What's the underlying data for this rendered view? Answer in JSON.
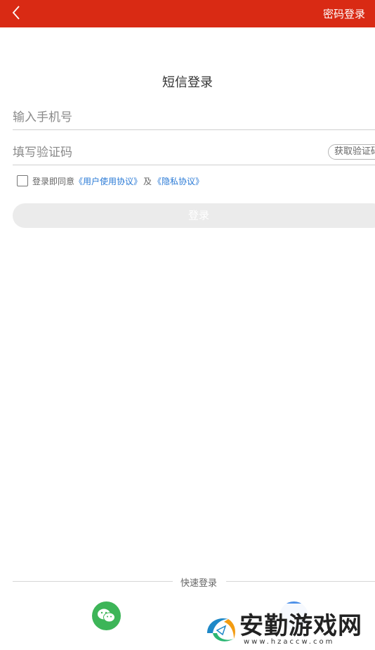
{
  "header": {
    "back_icon": "chevron-left-icon",
    "password_login": "密码登录",
    "bar_color": "#d92a14"
  },
  "form": {
    "title": "短信登录",
    "phone_placeholder": "输入手机号",
    "code_placeholder": "填写验证码",
    "get_code_label": "获取验证码",
    "agree_prefix": "登录即同意",
    "user_agreement": "《用户使用协议》",
    "agree_and": "及",
    "privacy_policy": "《隐私协议》",
    "login_label": "登录",
    "link_color": "#2a7ad6"
  },
  "quick_login": {
    "label": "快速登录",
    "wechat_icon": "wechat-icon",
    "qq_icon": "qq-icon"
  },
  "watermark": {
    "text": "安勤游戏网",
    "sub": "www.hzaccw.com"
  }
}
